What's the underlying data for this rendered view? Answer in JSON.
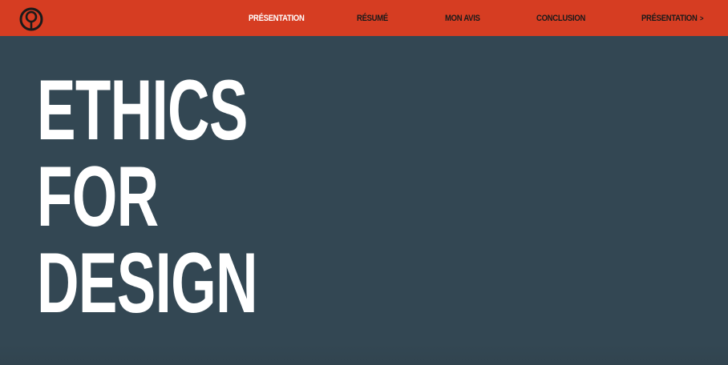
{
  "colors": {
    "nav_background": "#d63d22",
    "page_background": "#334753",
    "nav_text": "#1a1a1a",
    "nav_active_text": "#ffffff",
    "hero_text": "#ffffff"
  },
  "logo": {
    "icon": "ring-pin-logo-icon"
  },
  "nav": {
    "items": [
      {
        "label": "Présentation",
        "active": true
      },
      {
        "label": "Résumé",
        "active": false
      },
      {
        "label": "Mon avis",
        "active": false
      },
      {
        "label": "Conclusion",
        "active": false
      }
    ],
    "next": {
      "label": "Présentation",
      "icon": "chevron-right-icon",
      "glyph": ">"
    }
  },
  "hero": {
    "lines": [
      "ETHICS",
      "FOR",
      "DESIGN"
    ]
  }
}
